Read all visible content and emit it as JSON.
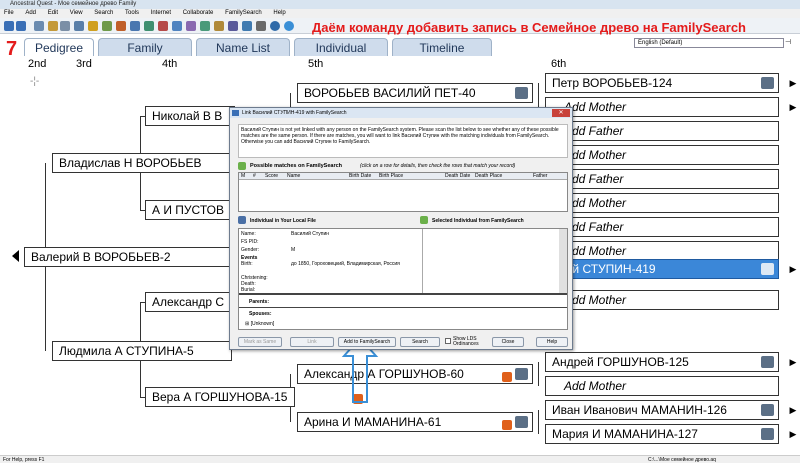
{
  "window": {
    "title": "Ancestral Quest - Мое семейное древо Family"
  },
  "menu": [
    "File",
    "Add",
    "Edit",
    "View",
    "Search",
    "Tools",
    "Internet",
    "Collaborate",
    "FamilySearch",
    "Help"
  ],
  "annotation": {
    "title": "Даём команду добавить запись в Семейное древо на FamilySearch",
    "step_number": "7"
  },
  "tabs": [
    "Pedigree",
    "Family",
    "Name List",
    "Individual",
    "Timeline"
  ],
  "language_select": "English (Default)",
  "generations": [
    "2nd",
    "3rd",
    "4th",
    "5th",
    "6th"
  ],
  "people": {
    "root": "Валерий В ВОРОБЬЕВ-2",
    "father": "Владислав Н ВОРОБЬЕВ",
    "mother": "Людмила А СТУПИНА-5",
    "ff": "Николай В В",
    "fm": "А И ПУСТОВ",
    "mf": "Александр С",
    "mm": "Вера А ГОРШУНОВА-15",
    "fff": "ВОРОБЬЕВ ВАСИЛИЙ ПЕТ-40",
    "mmf": "Александр А ГОРШУНОВ-60",
    "mmm": "Арина И МАМАНИНА-61",
    "g6_1": "Петр ВОРОБЬЕВ-124",
    "g6_2": "Add Mother",
    "g6_3": "Add Father",
    "g6_4": "Add Mother",
    "g6_5": "Add Father",
    "g6_6": "Add Mother",
    "g6_7": "Add Father",
    "g6_8": "Add Mother",
    "g6_9": "илий СТУПИН-419",
    "g6_10": "Add Mother",
    "g6_11": "Андрей ГОРШУНОВ-125",
    "g6_12": "Add Mother",
    "g6_13": "Иван Иванович МАМАНИН-126",
    "g6_14": "Мария И МАМАНИНА-127"
  },
  "dialog": {
    "title": "Link Василий СТУПИН-419 with FamilySearch",
    "info": "Василий Ступин is not yet linked with any person on the FamilySearch system. Please scan the list below to see whether any of these possible matches are the same person. If there are matches, you will want to link Василий Ступин with the matching individuals from FamilySearch. Otherwise you can add Василий Ступин to FamilySearch.",
    "matches_header": "Possible matches on FamilySearch",
    "matches_hint": "(click on a row for details, then check the rows that match your record)",
    "columns": [
      "M",
      "#",
      "Score",
      "Name",
      "Birth Date",
      "Birth Place",
      "Death Date",
      "Death Place",
      "Father"
    ],
    "local_header": "Individual in Your Local File",
    "selected_header": "Selected Individual from FamilySearch",
    "fields": [
      {
        "label": "Name:",
        "value": "Василий Ступин"
      },
      {
        "label": "FS PID:",
        "value": ""
      },
      {
        "label": "Gender:",
        "value": "M"
      },
      {
        "label": "Events",
        "value": ""
      },
      {
        "label": "Birth:",
        "value": "до 1850, Гороховецкий, Владимирская, Россия"
      },
      {
        "label": "Christening:",
        "value": ""
      },
      {
        "label": "Death:",
        "value": ""
      },
      {
        "label": "Burial:",
        "value": ""
      }
    ],
    "parents_label": "Parents:",
    "spouses_label": "Spouses:",
    "unknown": "[Unknown]",
    "buttons": {
      "mark_same": "Mark as Same",
      "link": "Link",
      "add": "Add to FamilySearch",
      "search": "Search",
      "show_lds": "Show LDS Ordinances",
      "close": "Close",
      "help": "Help"
    }
  },
  "status": {
    "left": "For Help, press F1",
    "right": "C:\\...\\Мое семейное древо.aq"
  },
  "colors": {
    "annotation": "#e41b1b",
    "highlight": "#3b87d8",
    "arrow": "#3a8fd6"
  }
}
